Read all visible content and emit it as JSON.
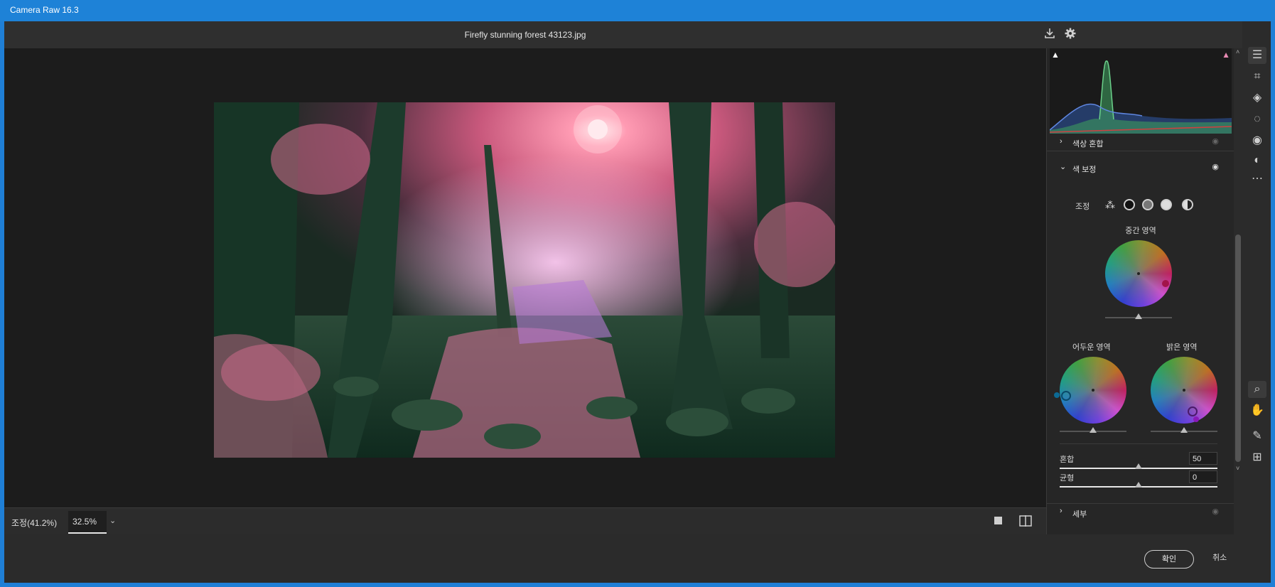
{
  "app": {
    "title": "Camera Raw 16.3"
  },
  "header": {
    "filename": "Firefly stunning forest 43123.jpg"
  },
  "icons": {
    "save": "download-icon",
    "settings": "gear-icon",
    "fullscreen": "expand-icon"
  },
  "histogram": {
    "label": "histogram"
  },
  "panel": {
    "sections": {
      "color_mixer": {
        "title": "색상 혼합"
      },
      "color_grading": {
        "title": "색 보정",
        "adjust_label": "조정"
      },
      "next": {
        "title": "세부"
      }
    },
    "wheels": {
      "midtones": {
        "label": "중간 영역"
      },
      "shadows": {
        "label": "어두운 영역"
      },
      "highlights": {
        "label": "밝은 영역"
      }
    },
    "blending": {
      "label": "혼합",
      "value": "50"
    },
    "balance": {
      "label": "균형",
      "value": "0"
    }
  },
  "bottombar": {
    "zoom_fit": "조정(41.2%)",
    "zoom_value": "32.5%"
  },
  "footer": {
    "ok": "확인",
    "cancel": "취소"
  },
  "toolstrip": [
    "edit-icon",
    "crop-icon",
    "eraser-icon",
    "mask-icon",
    "redeye-icon",
    "presets-icon",
    "more-icon",
    "zoom-icon",
    "hand-icon",
    "eyedropper-icon",
    "grid-icon"
  ]
}
